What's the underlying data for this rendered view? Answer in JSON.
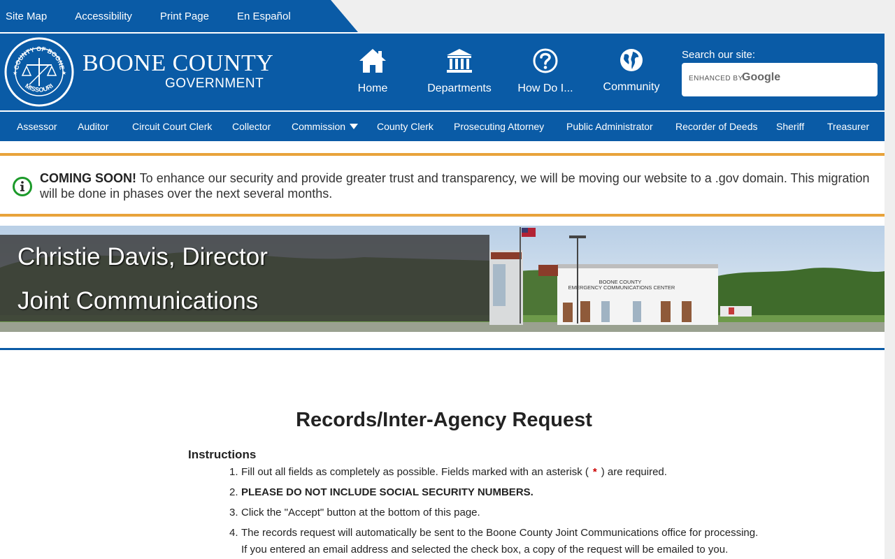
{
  "utility": {
    "links": [
      "Site Map",
      "Accessibility",
      "Print Page",
      "En Español"
    ]
  },
  "brand": {
    "seal_top": "COUNTY OF BOONE",
    "seal_bottom": "MISSOURI",
    "title": "BOONE COUNTY",
    "subtitle": "GOVERNMENT"
  },
  "main_nav": {
    "items": [
      {
        "label": "Home",
        "icon": "home-icon"
      },
      {
        "label": "Departments",
        "icon": "building-icon"
      },
      {
        "label": "How Do I...",
        "icon": "question-icon"
      },
      {
        "label": "Community",
        "icon": "globe-icon"
      }
    ]
  },
  "search": {
    "label": "Search our site:",
    "enhanced": "ENHANCED BY",
    "provider": "Google",
    "placeholder": ""
  },
  "dept_nav": {
    "items": [
      "Assessor",
      "Auditor",
      "Circuit Court Clerk",
      "Collector",
      "Commission",
      "County Clerk",
      "Prosecuting Attorney",
      "Public Administrator",
      "Recorder of Deeds",
      "Sheriff",
      "Treasurer"
    ]
  },
  "alert": {
    "heading": "COMING SOON!",
    "body": " To enhance our security and provide greater trust and transparency, we will be moving our website to a .gov domain. This migration will be done in phases over the next several months."
  },
  "banner": {
    "line1": "Christie Davis, Director",
    "line2": "Joint Communications",
    "building_sign_1": "BOONE COUNTY",
    "building_sign_2": "EMERGENCY COMMUNICATIONS CENTER"
  },
  "content": {
    "title": "Records/Inter-Agency Request",
    "instructions_heading": "Instructions",
    "steps": [
      {
        "n": "1.",
        "pre": "Fill out all fields as completely as possible. Fields marked with an asterisk (",
        "mark": "*",
        "post": ") are required."
      },
      {
        "n": "2.",
        "text": "PLEASE DO NOT INCLUDE SOCIAL SECURITY NUMBERS."
      },
      {
        "n": "3.",
        "text": "Click the \"Accept\" button at the bottom of this page."
      },
      {
        "n": "4.",
        "text": "The records request will automatically be sent to the Boone County Joint Communications office for processing.",
        "text2": "If you entered an email address and selected the check box, a copy of the request will be emailed to you."
      }
    ]
  },
  "colors": {
    "brand_blue": "#0a5ba6",
    "alert_orange": "#e8a33b",
    "alert_green": "#1c9a2a",
    "required_red": "#cc0000"
  }
}
